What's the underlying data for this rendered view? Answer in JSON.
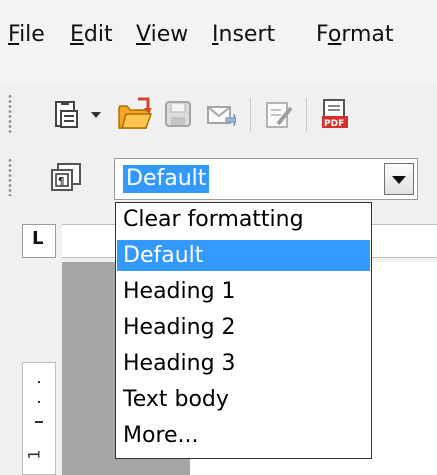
{
  "menubar": {
    "items": [
      {
        "label": "File",
        "mnemonic": "F"
      },
      {
        "label": "Edit",
        "mnemonic": "E"
      },
      {
        "label": "View",
        "mnemonic": "V"
      },
      {
        "label": "Insert",
        "mnemonic": "I"
      },
      {
        "label": "Format",
        "mnemonic": "o"
      }
    ]
  },
  "toolbar": {
    "icons": [
      "new-document-icon",
      "dropdown-arrow-icon",
      "open-folder-icon",
      "save-icon",
      "email-icon",
      "edit-file-icon",
      "export-pdf-icon"
    ]
  },
  "format_toolbar": {
    "styles_icon": "styles-formatting-icon",
    "paragraph_style": {
      "value": "Default",
      "options": [
        "Clear formatting",
        "Default",
        "Heading 1",
        "Heading 2",
        "Heading 3",
        "Text body",
        "More..."
      ],
      "selected_index": 1
    }
  },
  "ruler": {
    "tab_stop_marker": "L",
    "vertical_number": "1"
  },
  "colors": {
    "selection": "#3399ff",
    "page_background": "#a6a6a6"
  }
}
